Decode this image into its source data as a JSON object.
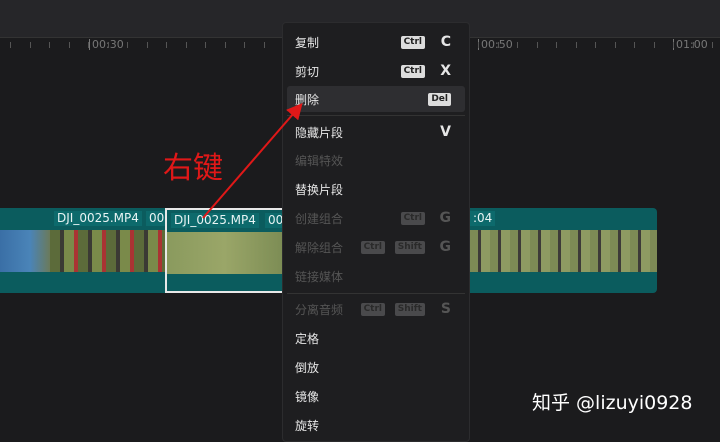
{
  "ruler": {
    "labels": [
      "00:30",
      "00:50",
      "01:00"
    ]
  },
  "clips": [
    {
      "name": "DJI_0025.MP4",
      "suffix": "00"
    },
    {
      "name": "DJI_0025.MP4",
      "suffix": "00"
    },
    {
      "name": ":04"
    }
  ],
  "context_menu": {
    "items": [
      {
        "label": "复制",
        "keys": [
          "Ctrl"
        ],
        "letter": "C",
        "enabled": true
      },
      {
        "label": "剪切",
        "keys": [
          "Ctrl"
        ],
        "letter": "X",
        "enabled": true
      },
      {
        "label": "删除",
        "keys": [
          "Del"
        ],
        "letter": "",
        "enabled": true,
        "highlighted": true
      },
      {
        "label": "隐藏片段",
        "keys": [],
        "letter": "V",
        "enabled": true
      },
      {
        "label": "编辑特效",
        "keys": [],
        "letter": "",
        "enabled": false
      },
      {
        "label": "替换片段",
        "keys": [],
        "letter": "",
        "enabled": true
      },
      {
        "label": "创建组合",
        "keys": [
          "Ctrl"
        ],
        "letter": "G",
        "enabled": false
      },
      {
        "label": "解除组合",
        "keys": [
          "Ctrl",
          "Shift"
        ],
        "letter": "G",
        "enabled": false
      },
      {
        "label": "链接媒体",
        "keys": [],
        "letter": "",
        "enabled": false
      },
      {
        "label": "分离音频",
        "keys": [
          "Ctrl",
          "Shift"
        ],
        "letter": "S",
        "enabled": false
      },
      {
        "label": "定格",
        "keys": [],
        "letter": "",
        "enabled": true
      },
      {
        "label": "倒放",
        "keys": [],
        "letter": "",
        "enabled": true
      },
      {
        "label": "镜像",
        "keys": [],
        "letter": "",
        "enabled": true
      },
      {
        "label": "旋转",
        "keys": [],
        "letter": "",
        "enabled": true
      }
    ]
  },
  "annotation": "右键",
  "watermark": "知乎 @lizuyi0928",
  "colors": {
    "track": "#0b5c5e",
    "annotation": "#e01818"
  }
}
